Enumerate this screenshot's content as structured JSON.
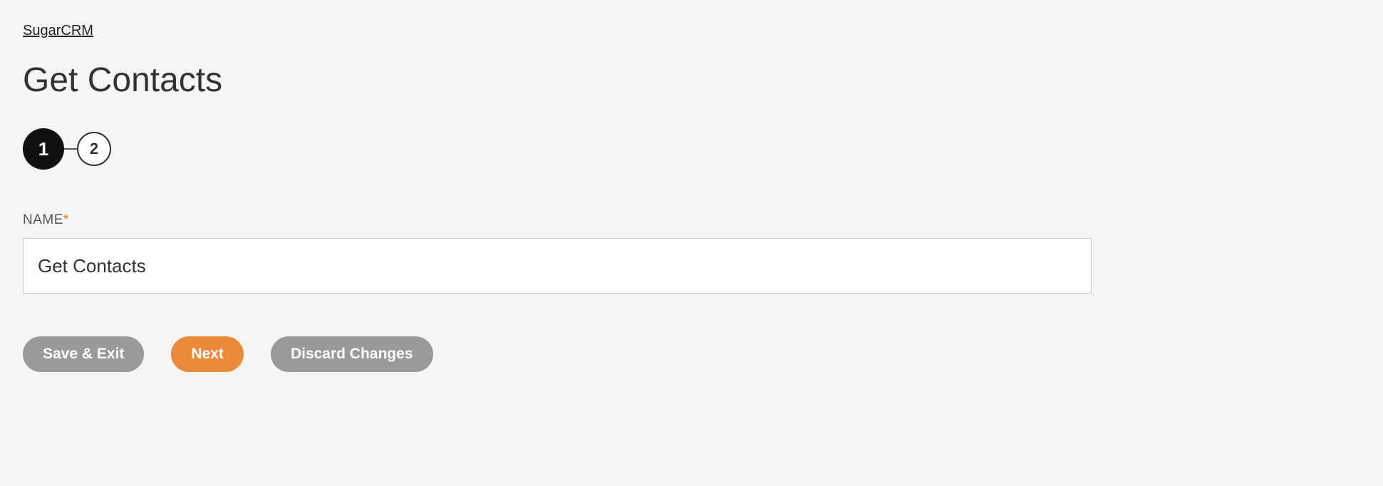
{
  "breadcrumb": {
    "label": "SugarCRM"
  },
  "page_title": "Get Contacts",
  "stepper": {
    "steps": [
      {
        "number": "1",
        "active": true
      },
      {
        "number": "2",
        "active": false
      }
    ]
  },
  "form": {
    "name_label": "NAME",
    "required_mark": "*",
    "name_value": "Get Contacts"
  },
  "buttons": {
    "save_exit": "Save & Exit",
    "next": "Next",
    "discard": "Discard Changes"
  }
}
